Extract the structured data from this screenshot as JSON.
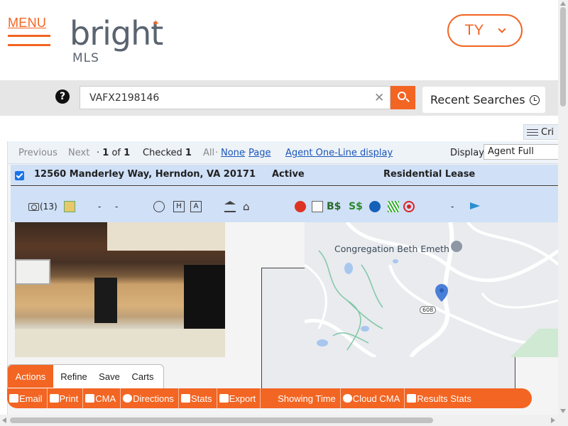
{
  "header": {
    "menu_label": "MENU",
    "logo_word": "bright",
    "logo_sub": "MLS",
    "user_initials": "TY"
  },
  "search": {
    "value": "VAFX2198146",
    "recent_label": "Recent Searches"
  },
  "criteria_label": "Cri",
  "toolbar": {
    "previous": "Previous",
    "next": "Next",
    "position_prefix": "·",
    "position_current": "1",
    "position_of": "of",
    "position_total": "1",
    "checked_label": "Checked",
    "checked_count": "1",
    "all_label": "All",
    "separator": "·",
    "none_link": "None",
    "page_link": "Page",
    "agent_oneline_link": "Agent One-Line display",
    "display_label": "Display",
    "display_value": "Agent Full"
  },
  "listing": {
    "address": "12560 Manderley Way, Herndon, VA 20171",
    "status": "Active",
    "type": "Residential Lease",
    "photo_count": "(13)",
    "dash": "-",
    "map_place": "Congregation Beth Emeth",
    "map_route": "608"
  },
  "action_tabs": [
    "Actions",
    "Refine",
    "Save",
    "Carts"
  ],
  "actions": [
    {
      "label": "Email",
      "icon": "email-icon"
    },
    {
      "label": "Print",
      "icon": "print-icon"
    },
    {
      "label": "CMA",
      "icon": "cma-icon"
    },
    {
      "label": "Directions",
      "icon": "compass-icon"
    },
    {
      "label": "Stats",
      "icon": "stats-icon"
    },
    {
      "label": "Export",
      "icon": "export-icon"
    },
    {
      "label": "Showing Time",
      "icon": ""
    },
    {
      "label": "Cloud CMA",
      "icon": "cloud-icon"
    },
    {
      "label": "Results Stats",
      "icon": "results-stats-icon"
    }
  ],
  "colors": {
    "brand": "#f26522",
    "row_highlight": "#cfe0f7",
    "link": "#1a55b8"
  }
}
